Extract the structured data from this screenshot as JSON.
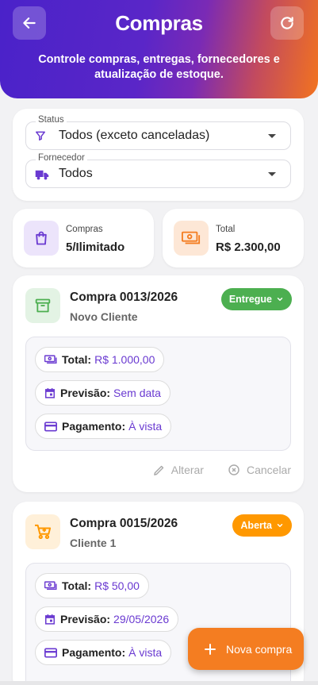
{
  "header": {
    "title": "Compras",
    "subtitle": "Controle compras, entregas, fornecedores e atualização de estoque.",
    "back_icon": "arrow-left-icon",
    "refresh_icon": "refresh-icon"
  },
  "filters": {
    "status": {
      "label": "Status",
      "value": "Todos (exceto canceladas)",
      "icon": "filter-icon"
    },
    "fornecedor": {
      "label": "Fornecedor",
      "value": "Todos",
      "icon": "truck-icon"
    }
  },
  "stats": {
    "compras": {
      "label": "Compras",
      "value": "5/Ilimitado",
      "icon": "shopping-bag-icon"
    },
    "total": {
      "label": "Total",
      "value": "R$ 2.300,00",
      "icon": "money-icon"
    }
  },
  "orders": [
    {
      "title": "Compra 0013/2026",
      "client": "Novo Cliente",
      "status": "Entregue",
      "status_color": "#4caf50",
      "icon": "archive-icon",
      "total_label": "Total:",
      "total_value": "R$ 1.000,00",
      "previsao_label": "Previsão:",
      "previsao_value": "Sem data",
      "pagamento_label": "Pagamento:",
      "pagamento_value": "À vista",
      "alterar_label": "Alterar",
      "cancelar_label": "Cancelar"
    },
    {
      "title": "Compra 0015/2026",
      "client": "Cliente 1",
      "status": "Aberta",
      "status_color": "#ff9800",
      "icon": "cart-icon",
      "total_label": "Total:",
      "total_value": "R$ 50,00",
      "previsao_label": "Previsão:",
      "previsao_value": "29/05/2026",
      "pagamento_label": "Pagamento:",
      "pagamento_value": "À vista"
    }
  ],
  "fab": {
    "label": "Nova compra",
    "icon": "plus-icon"
  },
  "colors": {
    "primary": "#6a3ad1",
    "accent": "#f47d21",
    "success": "#4caf50",
    "warning": "#ff9800"
  }
}
